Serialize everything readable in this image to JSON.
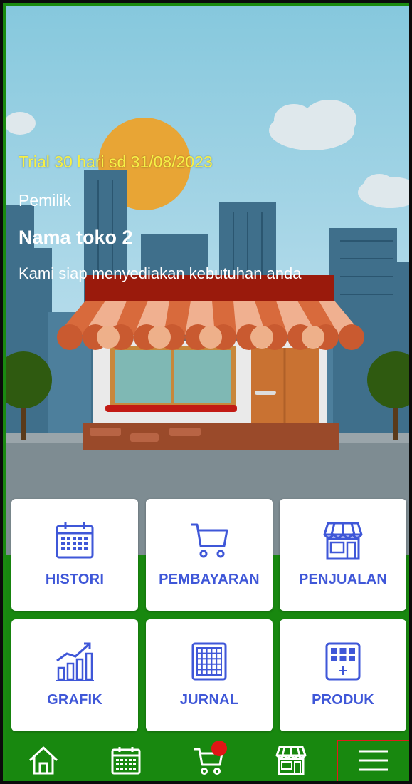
{
  "header": {
    "trial_text": "Trial 30 hari sd 31/08/2023",
    "role": "Pemilik",
    "store_name": "Nama toko 2",
    "tagline": "Kami siap menyediakan kebutuhan anda"
  },
  "menu": [
    {
      "label": "HISTORI",
      "icon": "calendar-icon"
    },
    {
      "label": "PEMBAYARAN",
      "icon": "cart-icon"
    },
    {
      "label": "PENJUALAN",
      "icon": "store-icon"
    },
    {
      "label": "GRAFIK",
      "icon": "chart-icon"
    },
    {
      "label": "JURNAL",
      "icon": "grid-icon"
    },
    {
      "label": "PRODUK",
      "icon": "product-icon"
    }
  ],
  "bottom_nav": [
    {
      "name": "home",
      "icon": "home-icon"
    },
    {
      "name": "calendar",
      "icon": "calendar-icon"
    },
    {
      "name": "cart",
      "icon": "cart-icon",
      "badge": true
    },
    {
      "name": "store",
      "icon": "store-icon"
    },
    {
      "name": "menu",
      "icon": "hamburger-menu-icon",
      "highlighted": true
    }
  ],
  "colors": {
    "accent": "#3f57d8",
    "green": "#18880f",
    "trial_text": "#f7f045",
    "badge": "#e01515",
    "highlight": "#e11b1b"
  }
}
